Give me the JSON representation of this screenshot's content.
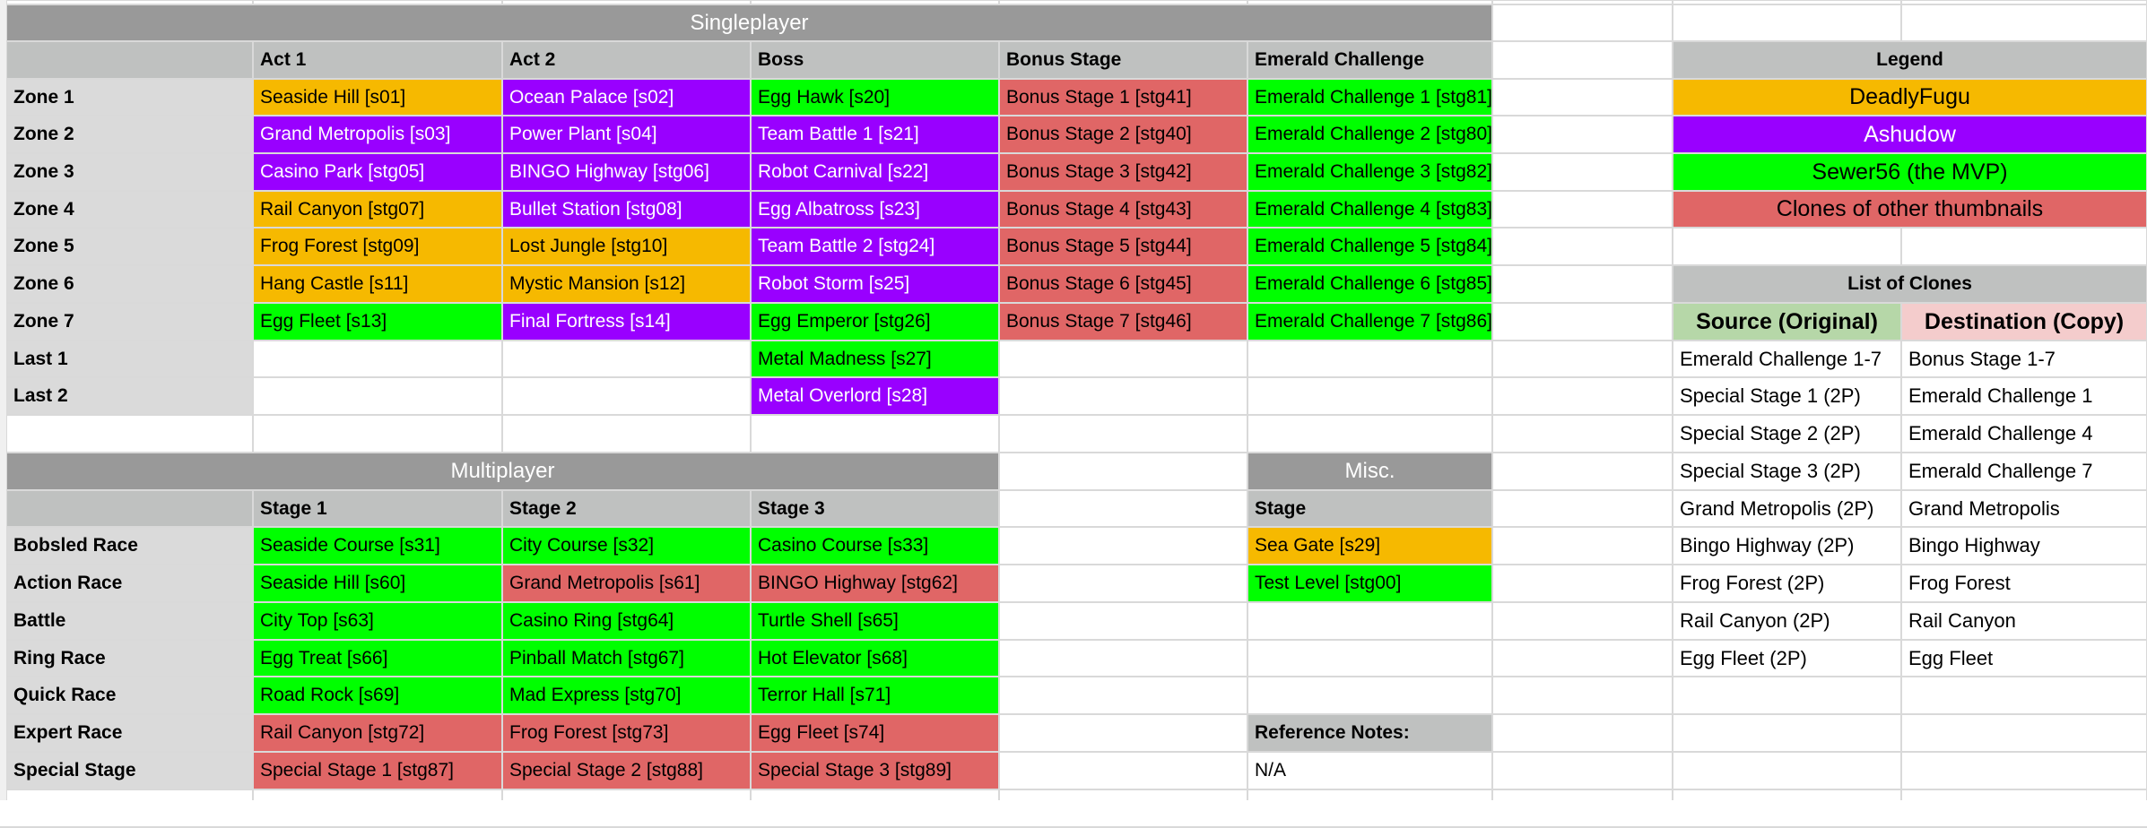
{
  "singleplayer": {
    "title": "Singleplayer",
    "columns": [
      "Act 1",
      "Act 2",
      "Boss",
      "Bonus Stage",
      "Emerald Challenge"
    ],
    "rows": [
      {
        "label": "Zone 1",
        "cells": [
          {
            "text": "Seaside Hill [s01]",
            "owner": "DeadlyFugu"
          },
          {
            "text": "Ocean Palace [s02]",
            "owner": "Ashudow"
          },
          {
            "text": "Egg Hawk [s20]",
            "owner": "Sewer56"
          },
          {
            "text": "Bonus Stage 1 [stg41]",
            "owner": "Clone"
          },
          {
            "text": "Emerald Challenge 1 [stg81]",
            "owner": "Sewer56"
          }
        ]
      },
      {
        "label": "Zone 2",
        "cells": [
          {
            "text": "Grand Metropolis [s03]",
            "owner": "Ashudow"
          },
          {
            "text": "Power Plant [s04]",
            "owner": "Ashudow"
          },
          {
            "text": "Team Battle 1 [s21]",
            "owner": "Ashudow"
          },
          {
            "text": "Bonus Stage 2 [stg40]",
            "owner": "Clone"
          },
          {
            "text": "Emerald Challenge 2 [stg80]",
            "owner": "Sewer56"
          }
        ]
      },
      {
        "label": "Zone 3",
        "cells": [
          {
            "text": "Casino Park [stg05]",
            "owner": "Ashudow"
          },
          {
            "text": "BINGO Highway [stg06]",
            "owner": "Ashudow"
          },
          {
            "text": "Robot Carnival [s22]",
            "owner": "Ashudow"
          },
          {
            "text": "Bonus Stage 3 [stg42]",
            "owner": "Clone"
          },
          {
            "text": "Emerald Challenge 3 [stg82]",
            "owner": "Sewer56"
          }
        ]
      },
      {
        "label": "Zone 4",
        "cells": [
          {
            "text": "Rail Canyon [stg07]",
            "owner": "DeadlyFugu"
          },
          {
            "text": "Bullet Station [stg08]",
            "owner": "Ashudow"
          },
          {
            "text": "Egg Albatross [s23]",
            "owner": "Ashudow"
          },
          {
            "text": "Bonus Stage 4 [stg43]",
            "owner": "Clone"
          },
          {
            "text": "Emerald Challenge 4 [stg83]",
            "owner": "Sewer56"
          }
        ]
      },
      {
        "label": "Zone 5",
        "cells": [
          {
            "text": "Frog Forest [stg09]",
            "owner": "DeadlyFugu"
          },
          {
            "text": "Lost Jungle [stg10]",
            "owner": "DeadlyFugu"
          },
          {
            "text": "Team Battle 2 [stg24]",
            "owner": "Ashudow"
          },
          {
            "text": "Bonus Stage 5 [stg44]",
            "owner": "Clone"
          },
          {
            "text": "Emerald Challenge 5 [stg84]",
            "owner": "Sewer56"
          }
        ]
      },
      {
        "label": "Zone 6",
        "cells": [
          {
            "text": "Hang Castle [s11]",
            "owner": "DeadlyFugu"
          },
          {
            "text": "Mystic Mansion [s12]",
            "owner": "DeadlyFugu"
          },
          {
            "text": "Robot Storm [s25]",
            "owner": "Ashudow"
          },
          {
            "text": "Bonus Stage 6 [stg45]",
            "owner": "Clone"
          },
          {
            "text": "Emerald Challenge 6 [stg85]",
            "owner": "Sewer56"
          }
        ]
      },
      {
        "label": "Zone 7",
        "cells": [
          {
            "text": "Egg Fleet [s13]",
            "owner": "Sewer56"
          },
          {
            "text": "Final Fortress [s14]",
            "owner": "Ashudow"
          },
          {
            "text": "Egg Emperor [stg26]",
            "owner": "Sewer56"
          },
          {
            "text": "Bonus Stage 7 [stg46]",
            "owner": "Clone"
          },
          {
            "text": "Emerald Challenge 7 [stg86]",
            "owner": "Sewer56"
          }
        ]
      },
      {
        "label": "Last 1",
        "cells": [
          null,
          null,
          {
            "text": "Metal Madness [s27]",
            "owner": "Sewer56"
          },
          null,
          null
        ]
      },
      {
        "label": "Last 2",
        "cells": [
          null,
          null,
          {
            "text": "Metal Overlord [s28]",
            "owner": "Ashudow"
          },
          null,
          null
        ]
      }
    ]
  },
  "multiplayer": {
    "title": "Multiplayer",
    "columns": [
      "Stage 1",
      "Stage 2",
      "Stage 3"
    ],
    "rows": [
      {
        "label": "Bobsled Race",
        "cells": [
          {
            "text": "Seaside Course [s31]",
            "owner": "Sewer56"
          },
          {
            "text": "City Course [s32]",
            "owner": "Sewer56"
          },
          {
            "text": "Casino Course [s33]",
            "owner": "Sewer56"
          }
        ]
      },
      {
        "label": "Action Race",
        "cells": [
          {
            "text": "Seaside Hill [s60]",
            "owner": "Sewer56"
          },
          {
            "text": "Grand Metropolis [s61]",
            "owner": "Clone"
          },
          {
            "text": "BINGO Highway [stg62]",
            "owner": "Clone"
          }
        ]
      },
      {
        "label": "Battle",
        "cells": [
          {
            "text": "City Top [s63]",
            "owner": "Sewer56"
          },
          {
            "text": "Casino Ring [stg64]",
            "owner": "Sewer56"
          },
          {
            "text": "Turtle Shell [s65]",
            "owner": "Sewer56"
          }
        ]
      },
      {
        "label": "Ring Race",
        "cells": [
          {
            "text": "Egg Treat [s66]",
            "owner": "Sewer56"
          },
          {
            "text": "Pinball Match [stg67]",
            "owner": "Sewer56"
          },
          {
            "text": "Hot Elevator [s68]",
            "owner": "Sewer56"
          }
        ]
      },
      {
        "label": "Quick Race",
        "cells": [
          {
            "text": "Road Rock [s69]",
            "owner": "Sewer56"
          },
          {
            "text": "Mad Express [stg70]",
            "owner": "Sewer56"
          },
          {
            "text": "Terror Hall [s71]",
            "owner": "Sewer56"
          }
        ]
      },
      {
        "label": "Expert Race",
        "cells": [
          {
            "text": "Rail Canyon [stg72]",
            "owner": "Clone"
          },
          {
            "text": "Frog Forest [stg73]",
            "owner": "Clone"
          },
          {
            "text": "Egg Fleet [s74]",
            "owner": "Clone"
          }
        ]
      },
      {
        "label": "Special Stage",
        "cells": [
          {
            "text": "Special Stage 1 [stg87]",
            "owner": "Clone"
          },
          {
            "text": "Special Stage 2 [stg88]",
            "owner": "Clone"
          },
          {
            "text": "Special Stage 3 [stg89]",
            "owner": "Clone"
          }
        ]
      }
    ]
  },
  "misc": {
    "title": "Misc.",
    "column": "Stage",
    "rows": [
      {
        "text": "Sea Gate [s29]",
        "owner": "DeadlyFugu"
      },
      {
        "text": "Test Level [stg00]",
        "owner": "Sewer56"
      }
    ],
    "notes_label": "Reference Notes:",
    "notes_value": "N/A"
  },
  "legend": {
    "title": "Legend",
    "items": [
      {
        "key": "DeadlyFugu",
        "label": "DeadlyFugu",
        "color": "#f6b900"
      },
      {
        "key": "Ashudow",
        "label": "Ashudow",
        "color": "#9900ff"
      },
      {
        "key": "Sewer56",
        "label": "Sewer56 (the MVP)",
        "color": "#00ff00"
      },
      {
        "key": "Clone",
        "label": "Clones of other thumbnails",
        "color": "#e06666"
      }
    ]
  },
  "clones": {
    "title": "List of Clones",
    "source_header": "Source (Original)",
    "dest_header": "Destination (Copy)",
    "rows": [
      {
        "source": "Emerald Challenge 1-7",
        "dest": "Bonus Stage 1-7"
      },
      {
        "source": "Special Stage 1 (2P)",
        "dest": "Emerald Challenge 1"
      },
      {
        "source": "Special Stage 2 (2P)",
        "dest": "Emerald Challenge 4"
      },
      {
        "source": "Special Stage 3 (2P)",
        "dest": "Emerald Challenge 7"
      },
      {
        "source": "Grand Metropolis (2P)",
        "dest": "Grand Metropolis"
      },
      {
        "source": "Bingo Highway (2P)",
        "dest": "Bingo Highway"
      },
      {
        "source": "Frog Forest (2P)",
        "dest": "Frog Forest"
      },
      {
        "source": "Rail Canyon (2P)",
        "dest": "Rail Canyon"
      },
      {
        "source": "Egg Fleet (2P)",
        "dest": "Egg Fleet"
      }
    ]
  }
}
